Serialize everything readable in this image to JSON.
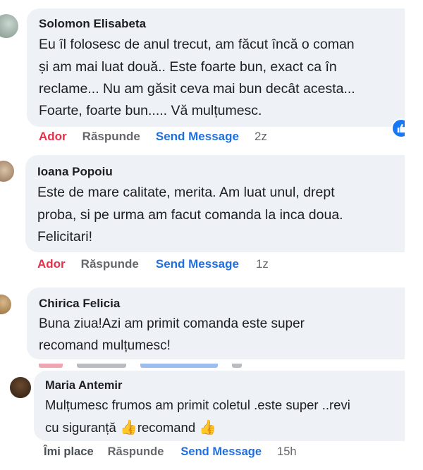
{
  "comments": [
    {
      "author": "Solomon Elisabeta",
      "lines": [
        "Eu îl folosesc de anul trecut, am făcut încă o coman",
        "și am mai luat două.. Este foarte bun, exact ca în",
        "reclame... Nu am găsit ceva mai bun decât acesta...",
        "Foarte, foarte bun..... Vă mulțumesc."
      ],
      "react_label": "Ador",
      "reply_label": "Răspunde",
      "message_label": "Send Message",
      "time": "2z"
    },
    {
      "author": "Ioana Popoiu",
      "lines": [
        "Este de mare calitate, merita. Am luat unul, drept",
        "proba, si pe urma am facut comanda la inca doua.",
        "Felicitari!"
      ],
      "react_label": "Ador",
      "reply_label": "Răspunde",
      "message_label": "Send Message",
      "time": "1z"
    },
    {
      "author": "Chirica Felicia",
      "lines": [
        "Buna ziua!Azi am primit comanda este super",
        "recomand mulțumesc!"
      ]
    },
    {
      "author": "Maria Antemir",
      "line1": "Mulțumesc frumos am primit coletul .este super ..revi",
      "line2_a": "cu siguranță",
      "line2_b": "recomand",
      "react_label": "Îmi place",
      "reply_label": "Răspunde",
      "message_label": "Send Message",
      "time": "15h"
    }
  ],
  "icons": {
    "like_badge": "thumbs-up-icon",
    "emoji": "thumbs-up-emoji-icon"
  },
  "colors": {
    "bubble": "#eef2f7",
    "react_love": "#e4314a",
    "send_message": "#1f6fe0",
    "meta": "#65676b"
  }
}
